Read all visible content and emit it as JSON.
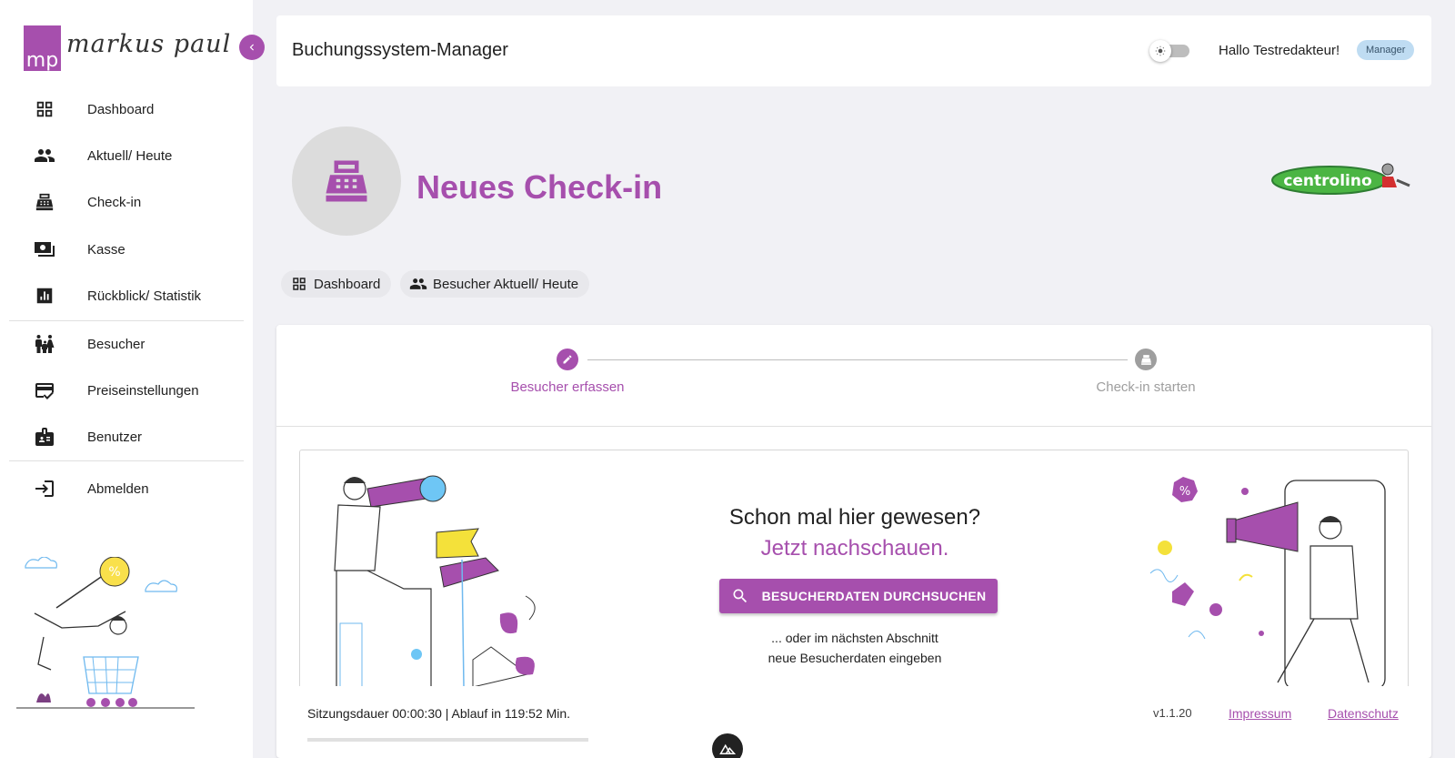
{
  "brand": {
    "logo_initials": "mp",
    "logo_name": "markus paul"
  },
  "sidebar": {
    "items": [
      {
        "label": "Dashboard",
        "icon": "dashboard-icon"
      },
      {
        "label": "Aktuell/ Heute",
        "icon": "people-icon"
      },
      {
        "label": "Check-in",
        "icon": "cash-register-icon"
      },
      {
        "label": "Kasse",
        "icon": "money-icon"
      },
      {
        "label": "Rückblick/ Statistik",
        "icon": "bar-chart-icon"
      },
      {
        "label": "Besucher",
        "icon": "family-icon"
      },
      {
        "label": "Preiseinstellungen",
        "icon": "card-check-icon"
      },
      {
        "label": "Benutzer",
        "icon": "badge-icon"
      },
      {
        "label": "Abmelden",
        "icon": "logout-icon"
      }
    ]
  },
  "header": {
    "title": "Buchungssystem-Manager",
    "greeting": "Hallo Testredakteur!",
    "role": "Manager"
  },
  "page": {
    "title": "Neues Check-in",
    "brand_logo_text": "centrolino",
    "chips": [
      {
        "label": "Dashboard",
        "icon": "dashboard-icon"
      },
      {
        "label": "Besucher Aktuell/ Heute",
        "icon": "people-icon"
      }
    ]
  },
  "stepper": {
    "steps": [
      {
        "label": "Besucher erfassen",
        "state": "active"
      },
      {
        "label": "Check-in starten",
        "state": "inactive"
      }
    ]
  },
  "search": {
    "question": "Schon mal hier gewesen?",
    "cta_text": "Jetzt nachschauen.",
    "button_label": "BESUCHERDATEN DURCHSUCHEN",
    "hint_line1": "... oder im nächsten Abschnitt",
    "hint_line2": "neue Besucherdaten eingeben"
  },
  "footer": {
    "session": "Sitzungsdauer 00:00:30 | Ablauf in 119:52 Min.",
    "session_progress": 0.0,
    "version": "v1.1.20",
    "impressum": "Impressum",
    "datenschutz": "Datenschutz"
  },
  "colors": {
    "accent": "#a64fad",
    "background": "#f1f1f5",
    "badge": "#bfdcf2"
  }
}
